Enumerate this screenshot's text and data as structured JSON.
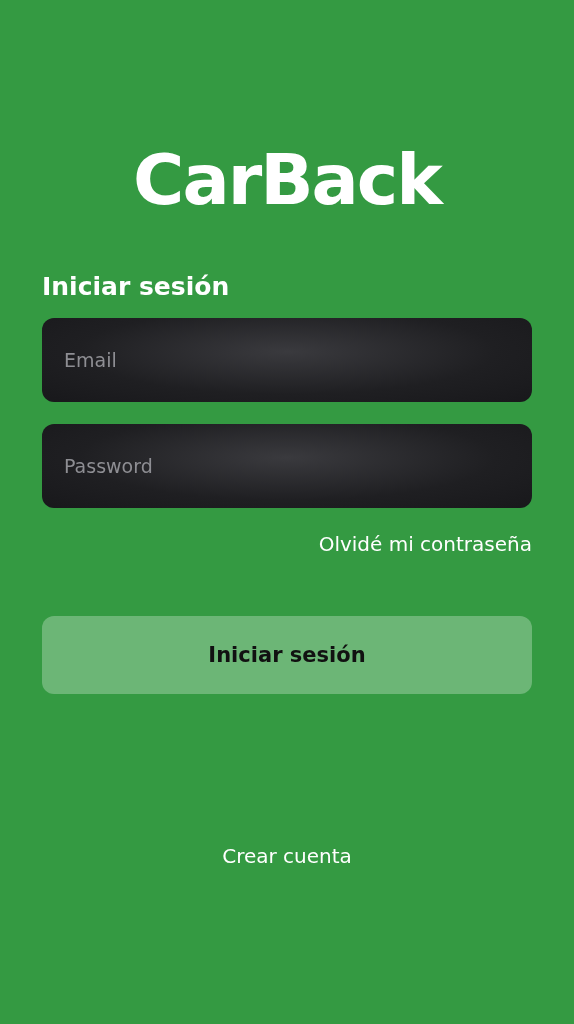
{
  "logo": {
    "text": "CarBack"
  },
  "title": "Iniciar sesión",
  "fields": [
    {
      "placeholder": "Email"
    },
    {
      "placeholder": "Password"
    }
  ],
  "forgot_link": "Olvidé mi contraseña",
  "login_button": {
    "label": "Iniciar sesión",
    "disabled": true
  },
  "create_account_link": "Crear cuenta"
}
